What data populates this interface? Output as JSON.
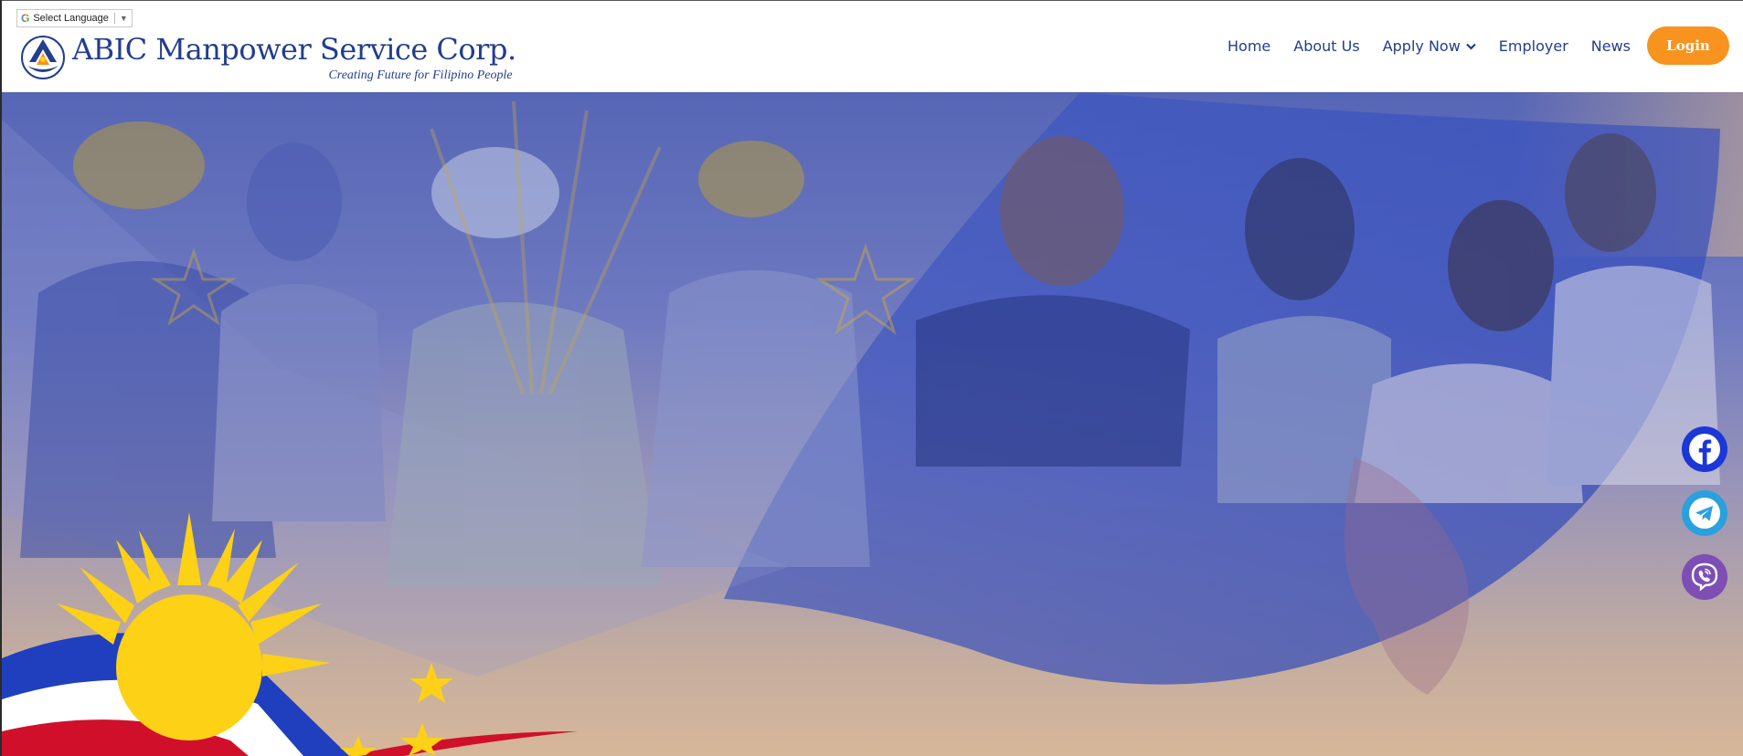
{
  "translate": {
    "label": "Select Language",
    "arrow": "▼",
    "icon": "google-g-icon"
  },
  "brand": {
    "name": "ABIC Manpower Service Corp.",
    "tagline": "Creating Future for Filipino People",
    "logo_icon": "abic-logo-icon"
  },
  "nav": {
    "items": [
      {
        "label": "Home"
      },
      {
        "label": "About Us"
      },
      {
        "label": "Apply Now",
        "has_dropdown": true
      },
      {
        "label": "Employer"
      },
      {
        "label": "News"
      }
    ],
    "login_label": "Login"
  },
  "social": [
    {
      "name": "facebook-icon",
      "color": "#1b37d6"
    },
    {
      "name": "telegram-icon",
      "color": "#2aa1de"
    },
    {
      "name": "viber-icon",
      "color": "#7d4fb4"
    }
  ],
  "colors": {
    "brand_blue": "#223e8c",
    "accent_orange": "#f7931e",
    "flag_blue": "#1f3fbf",
    "flag_red": "#d0102b",
    "sun_yellow": "#fcd116"
  }
}
